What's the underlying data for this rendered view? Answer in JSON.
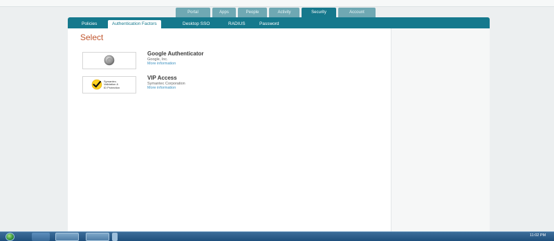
{
  "main_nav": {
    "tabs": [
      {
        "label": "Portal"
      },
      {
        "label": "Apps"
      },
      {
        "label": "People"
      },
      {
        "label": "Activity"
      },
      {
        "label": "Security",
        "active": true
      },
      {
        "label": "Account"
      }
    ]
  },
  "sub_nav": {
    "tabs": [
      {
        "label": "Policies"
      },
      {
        "label": "Authentication Factors",
        "active": true
      },
      {
        "label": "Desktop SSO"
      },
      {
        "label": "RADIUS"
      },
      {
        "label": "Password"
      }
    ]
  },
  "page": {
    "title": "Select"
  },
  "factors": [
    {
      "name": "Google Authenticator",
      "vendor": "Google, Inc.",
      "link": "More information",
      "icon": "google-authenticator-icon"
    },
    {
      "name": "VIP Access",
      "vendor": "Symantec Corporation",
      "link": "More information",
      "icon": "symantec-checkmark-icon",
      "logo_text": [
        "Symantec.",
        "Validation &",
        "ID Protection"
      ]
    }
  ],
  "taskbar": {
    "tray_items": [
      "11:02 PM"
    ]
  },
  "colors": {
    "accent": "#15798d",
    "tab_inactive": "#6fa8b3",
    "title": "#c0562e",
    "link": "#3a8fbf"
  }
}
